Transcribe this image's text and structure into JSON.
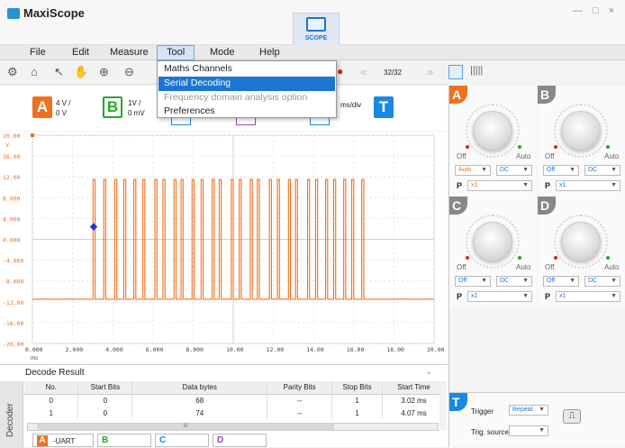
{
  "app": {
    "title": "MaxiScope",
    "window_controls": "— □ ×"
  },
  "mode_button": {
    "label": "SCOPE"
  },
  "menu": [
    "File",
    "Edit",
    "Measure",
    "Tool",
    "Mode",
    "Help"
  ],
  "tool_menu": {
    "items": [
      {
        "label": "Maths Channels",
        "state": "normal"
      },
      {
        "label": "Serial Decoding",
        "state": "highlighted"
      },
      {
        "label": "Frequency domain analysis option",
        "state": "disabled"
      },
      {
        "label": "Preferences",
        "state": "normal"
      }
    ]
  },
  "toolbar": {
    "page_counter": "32/32",
    "timebase_unit": "ms/div"
  },
  "channels": {
    "a": {
      "letter": "A",
      "scale": "4 V /",
      "offset": "0 V",
      "color": "#f07020"
    },
    "b": {
      "letter": "B",
      "scale": "1V /",
      "offset": "0 mV",
      "color": "#24a824"
    },
    "t": {
      "letter": "T",
      "color": "#1a88e0"
    }
  },
  "chart_data": {
    "type": "line",
    "y_ticks": [
      "20.00",
      "16.00",
      "12.00",
      "8.000",
      "4.000",
      "0.000",
      "-4.000",
      "-8.000",
      "-12.00",
      "-16.00",
      "-20.00"
    ],
    "y_unit": "V",
    "x_ticks": [
      "0.000",
      "2.000",
      "4.000",
      "6.000",
      "8.000",
      "10.00",
      "12.00",
      "14.00",
      "16.00",
      "18.00",
      "20.00"
    ],
    "x_unit": "ms",
    "ylim": [
      -20,
      20
    ],
    "xlim": [
      0,
      20
    ],
    "series": [
      {
        "color": "#f07020",
        "high": 11.5,
        "low": -11.5
      }
    ],
    "trigger_x": 3.05,
    "trigger_y": 2.4
  },
  "decoder": {
    "title": "Decode Result",
    "side_label": "Decoder",
    "columns": [
      "No.",
      "Start Bits",
      "Data bytes",
      "Parity Bits",
      "Stop Bits",
      "Start Time"
    ],
    "rows": [
      [
        "0",
        "0",
        "68",
        "--",
        "1",
        "3.02 ms"
      ],
      [
        "1",
        "0",
        "74",
        "--",
        "1",
        "4.07 ms"
      ]
    ],
    "scroll_mark": "III",
    "tabs": [
      {
        "letter": "A",
        "label": "-UART",
        "color": "#f07020"
      },
      {
        "letter": "B",
        "label": "",
        "color": "#24a824"
      },
      {
        "letter": "C",
        "label": "",
        "color": "#1a88e0"
      },
      {
        "letter": "D",
        "label": "",
        "color": "#a040d0"
      }
    ]
  },
  "right_panels": [
    {
      "letter": "A",
      "color": "#f07020",
      "off": "Off",
      "auto": "Auto",
      "coupling": "Auto",
      "mode": "DC",
      "probe_label": "P",
      "probe": "x1"
    },
    {
      "letter": "B",
      "color": "#888888",
      "off": "Off",
      "auto": "Auto",
      "coupling": "Off",
      "mode": "DC",
      "probe_label": "P",
      "probe": "x1"
    },
    {
      "letter": "C",
      "color": "#888888",
      "off": "Off",
      "auto": "Auto",
      "coupling": "Off",
      "mode": "DC",
      "probe_label": "P",
      "probe": "x1"
    },
    {
      "letter": "D",
      "color": "#888888",
      "off": "Off",
      "auto": "Auto",
      "coupling": "Off",
      "mode": "DC",
      "probe_label": "P",
      "probe": "x1"
    }
  ],
  "trigger_panel": {
    "letter": "T",
    "trigger_label": "Trigger",
    "trigger_value": "Repeat",
    "source_label": "Trig. source",
    "source_value": ""
  }
}
